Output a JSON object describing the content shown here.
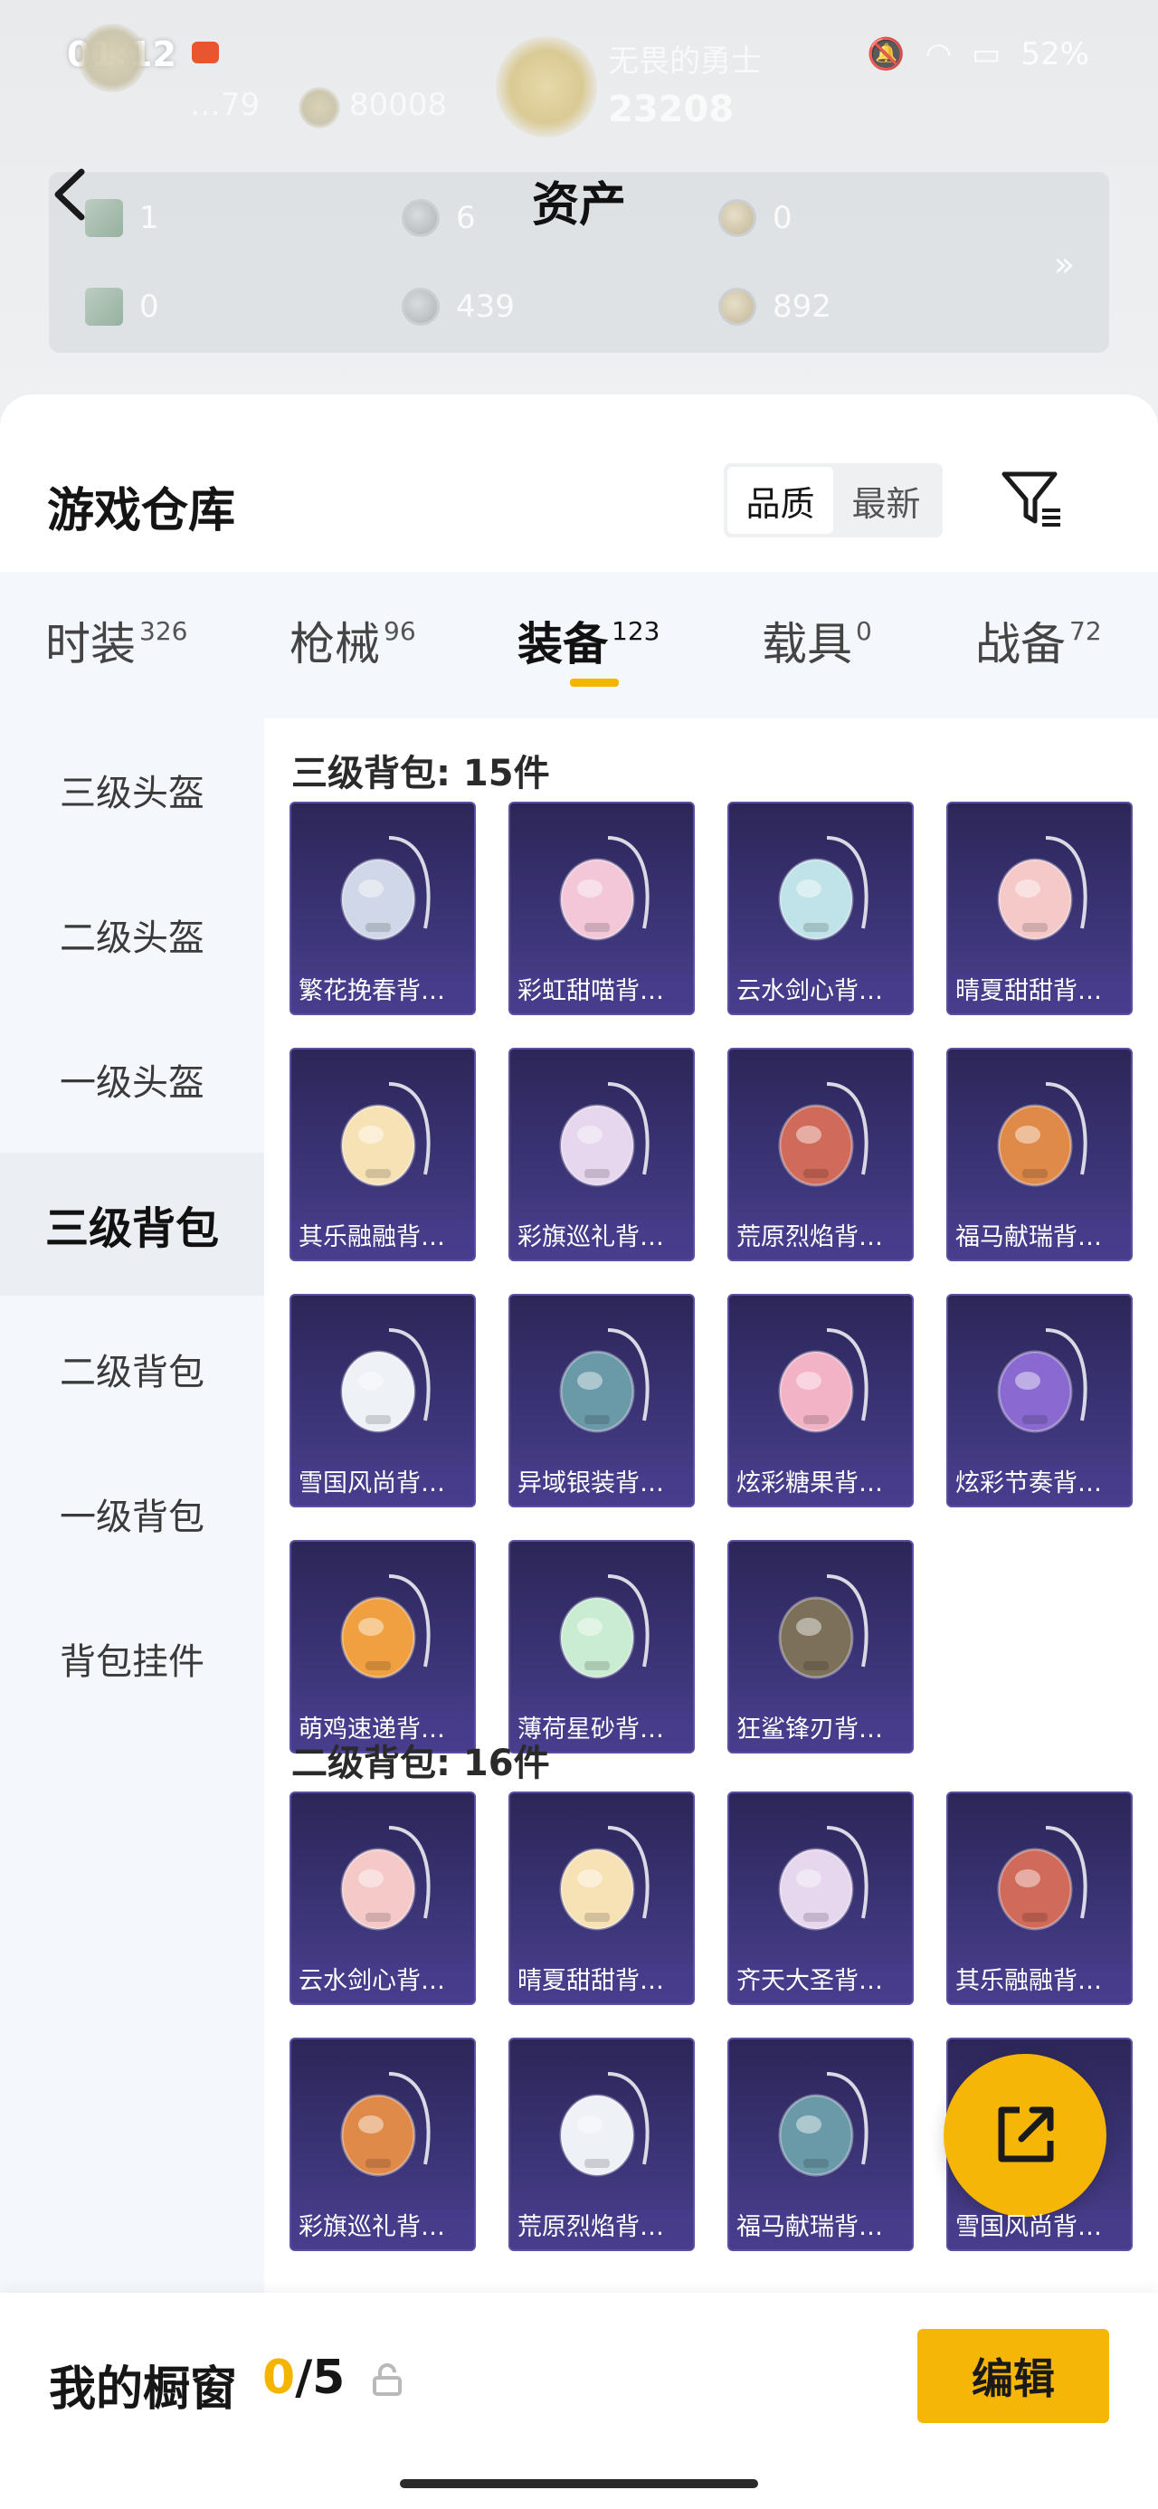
{
  "status_bar": {
    "time": "01:12",
    "battery": "52%"
  },
  "header": {
    "title": "资产",
    "blurred_score": "23208",
    "blurred_label": "无畏的勇士",
    "blurred_badge_value": "80008",
    "blurred_small": "…79"
  },
  "assets": [
    {
      "value": "1",
      "icon": "ticket-icon"
    },
    {
      "value": "6",
      "icon": "silver-coin-icon"
    },
    {
      "value": "0",
      "icon": "gold-coin-icon"
    },
    {
      "value": "0",
      "icon": "card-icon"
    },
    {
      "value": "439",
      "icon": "silver-coin-icon"
    },
    {
      "value": "892",
      "icon": "bronze-coin-icon"
    }
  ],
  "warehouse": {
    "title": "游戏仓库",
    "sort_quality": "品质",
    "sort_latest": "最新"
  },
  "tabs": [
    {
      "label": "时装",
      "count": "326"
    },
    {
      "label": "枪械",
      "count": "96"
    },
    {
      "label": "装备",
      "count": "123"
    },
    {
      "label": "载具",
      "count": "0"
    },
    {
      "label": "战备",
      "count": "72"
    }
  ],
  "sidebar": [
    "三级头盔",
    "二级头盔",
    "一级头盔",
    "三级背包",
    "二级背包",
    "一级背包",
    "背包挂件"
  ],
  "sections": [
    {
      "title": "三级背包: 15件",
      "items": [
        "繁花挽春背包...",
        "彩虹甜喵背包...",
        "云水剑心背包...",
        "晴夏甜甜背包...",
        "其乐融融背包...",
        "彩旗巡礼背包...",
        "荒原烈焰背包...",
        "福马献瑞背包...",
        "雪国风尚背包...",
        "异域银装背包...",
        "炫彩糖果背包...",
        "炫彩节奏背包...",
        "萌鸡速递背包...",
        "薄荷星砂背包...",
        "狂鲨锋刃背包..."
      ]
    },
    {
      "title": "二级背包: 16件",
      "items": [
        "云水剑心背包...",
        "晴夏甜甜背包...",
        "齐天大圣背包...",
        "其乐融融背包...",
        "彩旗巡礼背包...",
        "荒原烈焰背包...",
        "福马献瑞背包...",
        "雪国风尚背包..."
      ]
    }
  ],
  "showcase": {
    "label": "我的橱窗",
    "current": "0",
    "total": "/5",
    "edit": "编辑"
  },
  "colors": {
    "accent": "#f6b608",
    "tab_underline": "#f5b400",
    "card_bg": "#3b3476"
  }
}
